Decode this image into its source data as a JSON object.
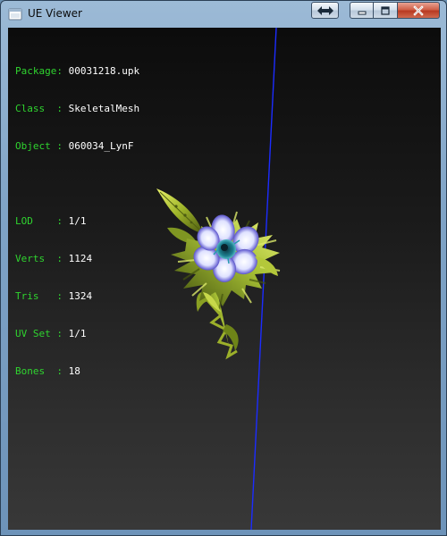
{
  "window": {
    "title": "UE Viewer",
    "icon": "ue-viewer-app-icon",
    "buttons": {
      "special": "swap-arrows-icon",
      "minimize": "minimize-icon",
      "maximize": "maximize-icon",
      "close": "close-icon"
    }
  },
  "colors": {
    "label": "#2fd42f",
    "value": "#ffffff",
    "axis_line": "#1c2cff",
    "viewport_top": "#0c0c0c",
    "viewport_bottom": "#383838"
  },
  "info": {
    "package": {
      "label": "Package: ",
      "value": "00031218.upk"
    },
    "class": {
      "label": "Class  : ",
      "value": "SkeletalMesh"
    },
    "object": {
      "label": "Object : ",
      "value": "060034_LynF"
    },
    "lod": {
      "label": "LOD    : ",
      "value": "1/1"
    },
    "verts": {
      "label": "Verts  : ",
      "value": "1124"
    },
    "tris": {
      "label": "Tris   : ",
      "value": "1324"
    },
    "uvset": {
      "label": "UV Set : ",
      "value": "1/1"
    },
    "bones": {
      "label": "Bones  : ",
      "value": "18"
    }
  },
  "scene": {
    "model": "flower-plant-mesh"
  }
}
